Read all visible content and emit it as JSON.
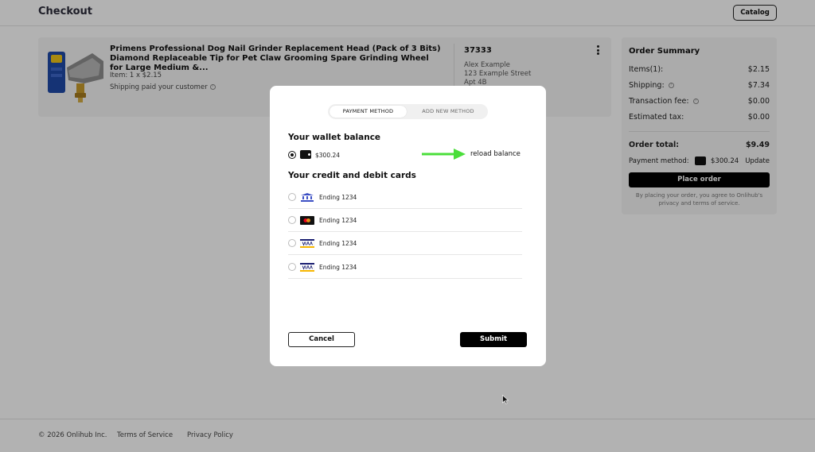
{
  "header": {
    "title": "Checkout",
    "catalog_label": "Catalog"
  },
  "product": {
    "title": "Primens Professional Dog Nail Grinder Replacement Head (Pack of 3 Bits) Diamond Replaceable Tip for Pet Claw Grooming Spare Grinding Wheel for Large Medium &...",
    "qty_price": "Item: 1 x $2.15",
    "shipping": "Shipping paid your customer",
    "order_number": "37333",
    "address": [
      "Alex Example",
      "123 Example Street",
      "Apt 4B"
    ]
  },
  "summary": {
    "title": "Order Summary",
    "rows": [
      {
        "label": "Items(1):",
        "value": "$2.15"
      },
      {
        "label": "Shipping:",
        "value": "$7.34"
      },
      {
        "label": "Transaction fee:",
        "value": "$0.00"
      },
      {
        "label": "Estimated tax:",
        "value": "$0.00"
      }
    ],
    "total_label": "Order total:",
    "total_value": "$9.49",
    "payment_method_label": "Payment method:",
    "payment_method_amount": "$300.24",
    "update_label": "Update",
    "place_order_label": "Place order",
    "disclaimer": "By placing your order, you agree to Onlihub's privacy and terms of service."
  },
  "footer": {
    "copyright": "© 2026 Onlihub Inc.",
    "terms": "Terms of Service",
    "privacy": "Privacy Policy"
  },
  "modal": {
    "tabs": [
      {
        "label": "PAYMENT METHOD",
        "active": true
      },
      {
        "label": "ADD NEW METHOD",
        "active": false
      }
    ],
    "wallet_title": "Your wallet balance",
    "wallet_amount": "$300.24",
    "reload_label": "reload balance",
    "cards_title": "Your credit and debit cards",
    "cards": [
      {
        "icon": "bank-icon",
        "label": "Ending 1234"
      },
      {
        "icon": "mastercard-icon",
        "label": "Ending 1234"
      },
      {
        "icon": "visa-icon",
        "label": "Ending 1234"
      },
      {
        "icon": "visa-icon",
        "label": "Ending 1234"
      }
    ],
    "cancel_label": "Cancel",
    "submit_label": "Submit"
  },
  "colors": {
    "accent": "#000000",
    "overlay": "rgba(0,0,0,0.30)",
    "arrow": "#4ade3a",
    "bank_blue": "#3b4fc4",
    "visa_blue": "#1a1f71",
    "visa_gold": "#f7b600",
    "mastercard_red": "#eb001b",
    "mastercard_orange": "#f79e1b"
  }
}
